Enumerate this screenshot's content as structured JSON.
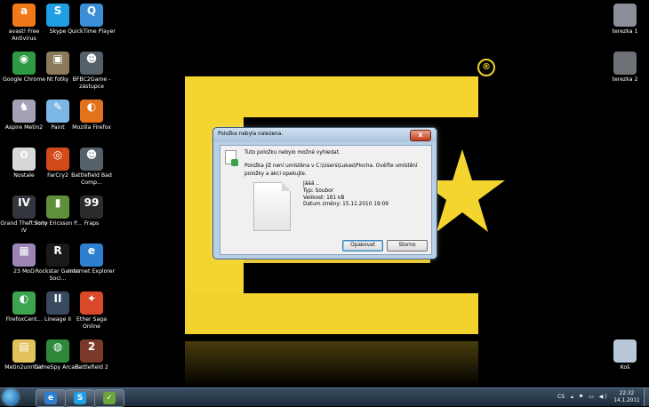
{
  "colors": {
    "wallpaper_yellow": "#f4d42f",
    "dialog_frame": "#b9cfe6",
    "taskbar": "#2a3c4e"
  },
  "desktop_icons_left": [
    {
      "label": "avast! Free Antivirus",
      "icon": "avast-icon",
      "color": "#f07a1a",
      "glyph": "a"
    },
    {
      "label": "Skype",
      "icon": "skype-icon",
      "color": "#1fa0e6",
      "glyph": "S"
    },
    {
      "label": "QuickTime Player",
      "icon": "quicktime-icon",
      "color": "#3a8fd8",
      "glyph": "Q"
    },
    {
      "label": "Google Chrome",
      "icon": "chrome-icon",
      "color": "#2e9a45",
      "glyph": "◉"
    },
    {
      "label": "Nt fotky",
      "icon": "photo-folder-icon",
      "color": "#8a7a5a",
      "glyph": "▣"
    },
    {
      "label": "BFBC2Game - zástupce",
      "icon": "bfbc2-icon",
      "color": "#55606b",
      "glyph": "☻"
    },
    {
      "label": "Aspire Metin2",
      "icon": "metin2-icon",
      "color": "#a7a1b7",
      "glyph": "♞"
    },
    {
      "label": "Paint",
      "icon": "paint-icon",
      "color": "#7db7e6",
      "glyph": "✎"
    },
    {
      "label": "Mozilla Firefox",
      "icon": "firefox-icon",
      "color": "#e2731c",
      "glyph": "◐"
    },
    {
      "label": "Nostale",
      "icon": "nostale-icon",
      "color": "#d8d8d8",
      "glyph": "✿"
    },
    {
      "label": "FarCry2",
      "icon": "farcry2-icon",
      "color": "#d24a1a",
      "glyph": "◎"
    },
    {
      "label": "Battlefield Bad Comp...",
      "icon": "battlefield-icon",
      "color": "#55606b",
      "glyph": "☻"
    },
    {
      "label": "Grand Theft Auto IV",
      "icon": "gta4-icon",
      "color": "#33373d",
      "glyph": "IV"
    },
    {
      "label": "Sony Ericsson P...",
      "icon": "sony-ericsson-icon",
      "color": "#5f8f3a",
      "glyph": "▮"
    },
    {
      "label": "Fraps",
      "icon": "fraps-icon",
      "color": "#2b2b2b",
      "glyph": "99"
    },
    {
      "label": "23 MoD",
      "icon": "mod-icon",
      "color": "#9d84b6",
      "glyph": "▦"
    },
    {
      "label": "Rockstar Games Soci...",
      "icon": "rockstar-icon",
      "color": "#1a1a1a",
      "glyph": "R"
    },
    {
      "label": "Internet Explorer",
      "icon": "ie-icon",
      "color": "#2f7fd1",
      "glyph": "e"
    },
    {
      "label": "FirefoxCent...",
      "icon": "firefox-center-icon",
      "color": "#3da34f",
      "glyph": "◐"
    },
    {
      "label": "Lineage II",
      "icon": "lineage2-icon",
      "color": "#3a4a5e",
      "glyph": "II"
    },
    {
      "label": "Ether Saga Online",
      "icon": "ether-saga-icon",
      "color": "#d84a2a",
      "glyph": "✦"
    },
    {
      "label": "Metin2unrited",
      "icon": "folder-icon",
      "color": "#e2c25a",
      "glyph": "▤"
    },
    {
      "label": "GameSpy Arcade",
      "icon": "gamespy-icon",
      "color": "#2e8a3a",
      "glyph": "◍"
    },
    {
      "label": "Battlefield 2",
      "icon": "battlefield2-icon",
      "color": "#7a3a2a",
      "glyph": "2"
    }
  ],
  "desktop_icons_right": [
    {
      "label": "terezka 1",
      "icon": "terezka1-image-icon"
    },
    {
      "label": "terezka 2",
      "icon": "terezka2-image-icon"
    },
    {
      "label": "Koš",
      "icon": "recycle-bin-icon"
    }
  ],
  "dialog": {
    "title": "Položka nebyla nalezena.",
    "message_main": "Tuto položku nebylo možné vyhledat.",
    "message_detail": "Položka již není umístěna v C:\\Users\\Lukas\\Plocha. Ověřte umístění položky a akci opakujte.",
    "file_name": "Jááá ..",
    "file_type": "Typ: Soubor",
    "file_size": "Velikost: 181 kB",
    "file_date": "Datum změny: 15.11.2010 19:09",
    "retry_label": "Opakovat",
    "cancel_label": "Storno",
    "close_glyph": "x"
  },
  "taskbar": {
    "language": "CS",
    "time": "22:32",
    "date": "14.1.2011",
    "tray_glyphs": "▴ ⚑ ▭ ◀)",
    "pinned": [
      {
        "icon": "internet-explorer-taskbar-icon",
        "color": "#2f7fd1",
        "glyph": "e"
      },
      {
        "icon": "skype-taskbar-icon",
        "color": "#1fa0e6",
        "glyph": "S"
      },
      {
        "icon": "explorer-taskbar-icon",
        "color": "#6aa53c",
        "glyph": "✓"
      }
    ]
  },
  "wallpaper": {
    "registered_mark": "®"
  }
}
